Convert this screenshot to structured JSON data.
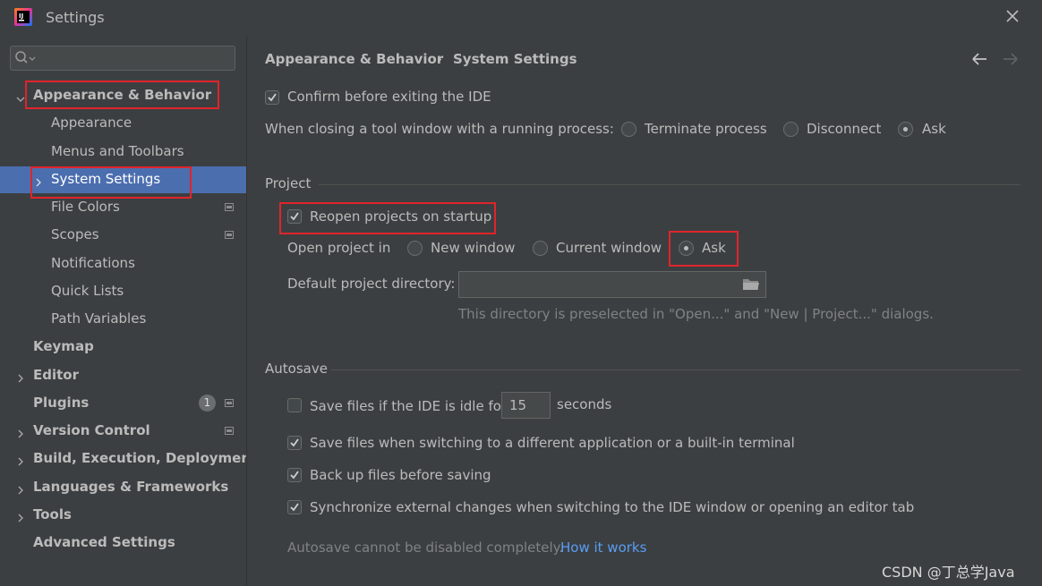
{
  "window": {
    "title": "Settings",
    "app_icon": "intellij-idea-icon",
    "close_icon": "close-icon"
  },
  "sidebar": {
    "search": {
      "value": "",
      "placeholder": ""
    },
    "items": [
      {
        "label": "Appearance & Behavior",
        "bold": true,
        "expanded": true
      },
      {
        "label": "Appearance"
      },
      {
        "label": "Menus and Toolbars"
      },
      {
        "label": "System Settings",
        "selected": true
      },
      {
        "label": "File Colors"
      },
      {
        "label": "Scopes"
      },
      {
        "label": "Notifications"
      },
      {
        "label": "Quick Lists"
      },
      {
        "label": "Path Variables"
      },
      {
        "label": "Keymap",
        "bold": true
      },
      {
        "label": "Editor",
        "bold": true
      },
      {
        "label": "Plugins",
        "bold": true,
        "badge": "1"
      },
      {
        "label": "Version Control",
        "bold": true
      },
      {
        "label": "Build, Execution, Deployment",
        "bold": true
      },
      {
        "label": "Languages & Frameworks",
        "bold": true
      },
      {
        "label": "Tools",
        "bold": true
      },
      {
        "label": "Advanced Settings",
        "bold": true
      }
    ]
  },
  "breadcrumb": {
    "parent": "Appearance & Behavior",
    "separator": "›",
    "current": "System Settings",
    "back_icon": "arrow-left-icon",
    "forward_icon": "arrow-right-icon"
  },
  "general": {
    "confirm_exit": {
      "label": "Confirm before exiting the IDE",
      "checked": true
    },
    "closing_label": "When closing a tool window with a running process:",
    "closing_options": [
      "Terminate process",
      "Disconnect",
      "Ask"
    ],
    "closing_selected": "Ask"
  },
  "project": {
    "section_title": "Project",
    "reopen": {
      "label": "Reopen projects on startup",
      "checked": true
    },
    "open_in_label": "Open project in",
    "open_in_options": [
      "New window",
      "Current window",
      "Ask"
    ],
    "open_in_selected": "Ask",
    "default_dir_label": "Default project directory:",
    "default_dir_value": "",
    "folder_icon": "folder-icon",
    "default_dir_hint": "This directory is preselected in \"Open...\" and \"New | Project...\" dialogs."
  },
  "autosave": {
    "section_title": "Autosave",
    "idle": {
      "label": "Save files if the IDE is idle for",
      "checked": false,
      "value": "15",
      "unit": "seconds"
    },
    "switching": {
      "label": "Save files when switching to a different application or a built-in terminal",
      "checked": true
    },
    "backup": {
      "label": "Back up files before saving",
      "checked": true
    },
    "sync": {
      "label": "Synchronize external changes when switching to the IDE window or opening an editor tab",
      "checked": true
    },
    "note": "Autosave cannot be disabled completely.",
    "link": "How it works"
  },
  "watermark": "CSDN @丁总学Java",
  "colors": {
    "background": "#3c3f41",
    "selection": "#4b6eaf",
    "annotation_red": "#e0242c",
    "link": "#589df6"
  }
}
